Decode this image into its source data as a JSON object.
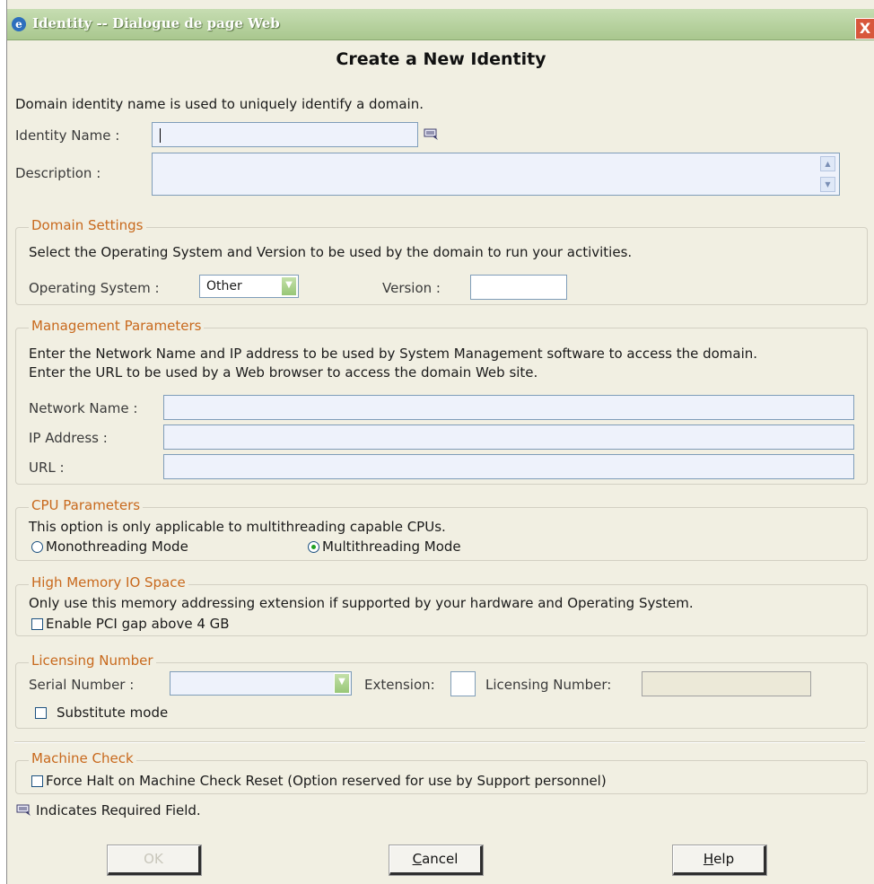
{
  "window": {
    "title": "Identity -- Dialogue de page Web",
    "close_label": "X"
  },
  "heading": "Create a New Identity",
  "identity": {
    "intro": "Domain identity name is used to uniquely identify a domain.",
    "name_label": "Identity Name :",
    "name_value": "",
    "description_label": "Description :",
    "description_value": ""
  },
  "domain_settings": {
    "legend": "Domain Settings",
    "intro": "Select the Operating System and Version to be used by the domain to run your activities.",
    "os_label": "Operating System :",
    "os_value": "Other",
    "version_label": "Version :",
    "version_value": ""
  },
  "management": {
    "legend": "Management Parameters",
    "line1": "Enter the Network Name and IP address to be used by System Management software to access the domain.",
    "line2": "Enter the URL to be used by a Web browser to access the domain Web site.",
    "network_label": "Network Name :",
    "ip_label": "IP Address :",
    "url_label": "URL :"
  },
  "cpu": {
    "legend": "CPU Parameters",
    "intro": "This option is only applicable to multithreading capable CPUs.",
    "mono_label": "Monothreading Mode",
    "multi_label": "Multithreading Mode",
    "selected": "Multithreading Mode"
  },
  "high_memory": {
    "legend": "High Memory IO Space",
    "intro": "Only use this memory addressing extension if supported by your hardware and Operating System.",
    "pci_label": "Enable PCI gap above 4 GB",
    "pci_checked": false
  },
  "licensing": {
    "legend": "Licensing Number",
    "serial_label": "Serial Number :",
    "serial_value": "",
    "extension_label": "Extension:",
    "licnum_label": "Licensing Number:",
    "substitute_label": "Substitute mode",
    "substitute_checked": false
  },
  "machine_check": {
    "legend": "Machine Check",
    "force_label": "Force Halt on Machine Check Reset (Option reserved for use by Support personnel)",
    "force_checked": false
  },
  "required_note": "Indicates Required Field.",
  "buttons": {
    "ok": "OK",
    "cancel_rest": "ancel",
    "cancel_mnemonic": "C",
    "help_rest": "elp",
    "help_mnemonic": "H"
  },
  "colors": {
    "titlebar": "#a9c78e",
    "legend_text": "#c8691d",
    "dialog_bg": "#f1efe2",
    "field_bg": "#eef2fb"
  }
}
